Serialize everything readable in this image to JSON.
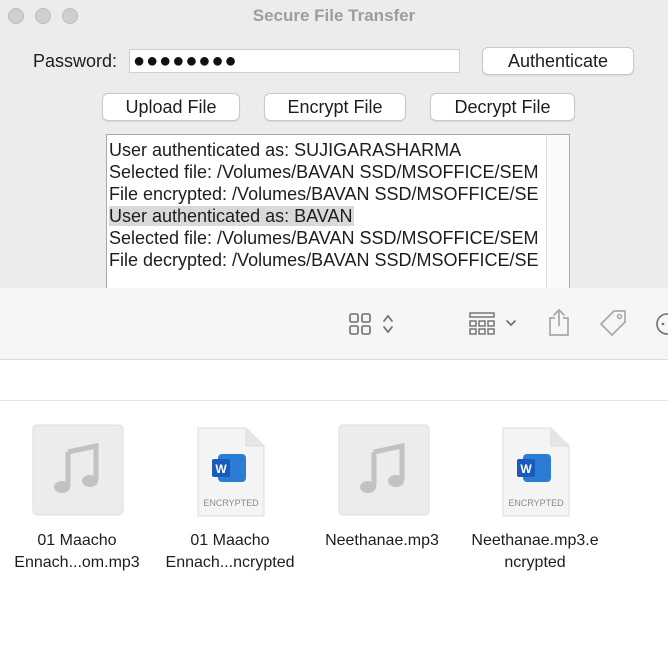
{
  "window": {
    "title": "Secure File Transfer"
  },
  "auth": {
    "password_label": "Password:",
    "password_value": "●●●●●●●●",
    "authenticate_label": "Authenticate"
  },
  "actions": {
    "upload_label": "Upload File",
    "encrypt_label": "Encrypt File",
    "decrypt_label": "Decrypt File"
  },
  "log": {
    "lines": [
      "User authenticated as: SUJIGARASHARMA",
      "Selected file: /Volumes/BAVAN SSD/MSOFFICE/SEM",
      "File encrypted: /Volumes/BAVAN SSD/MSOFFICE/SE",
      "User authenticated as: BAVAN",
      "Selected file: /Volumes/BAVAN SSD/MSOFFICE/SEM",
      "File decrypted: /Volumes/BAVAN SSD/MSOFFICE/SE"
    ],
    "selected_index": 3
  },
  "finder": {
    "files": [
      {
        "name_line1": "01 Maacho",
        "name_line2": "Ennach...om.mp3",
        "kind": "audio",
        "icon": "music-note-icon"
      },
      {
        "name_line1": "01 Maacho",
        "name_line2": "Ennach...ncrypted",
        "kind": "word-encrypted",
        "icon": "word-document-icon",
        "badge": "ENCRYPTED"
      },
      {
        "name_line1": "Neethanae.mp3",
        "name_line2": "",
        "kind": "audio",
        "icon": "music-note-icon"
      },
      {
        "name_line1": "Neethanae.mp3.e",
        "name_line2": "ncrypted",
        "kind": "word-encrypted",
        "icon": "word-document-icon",
        "badge": "ENCRYPTED"
      }
    ]
  }
}
